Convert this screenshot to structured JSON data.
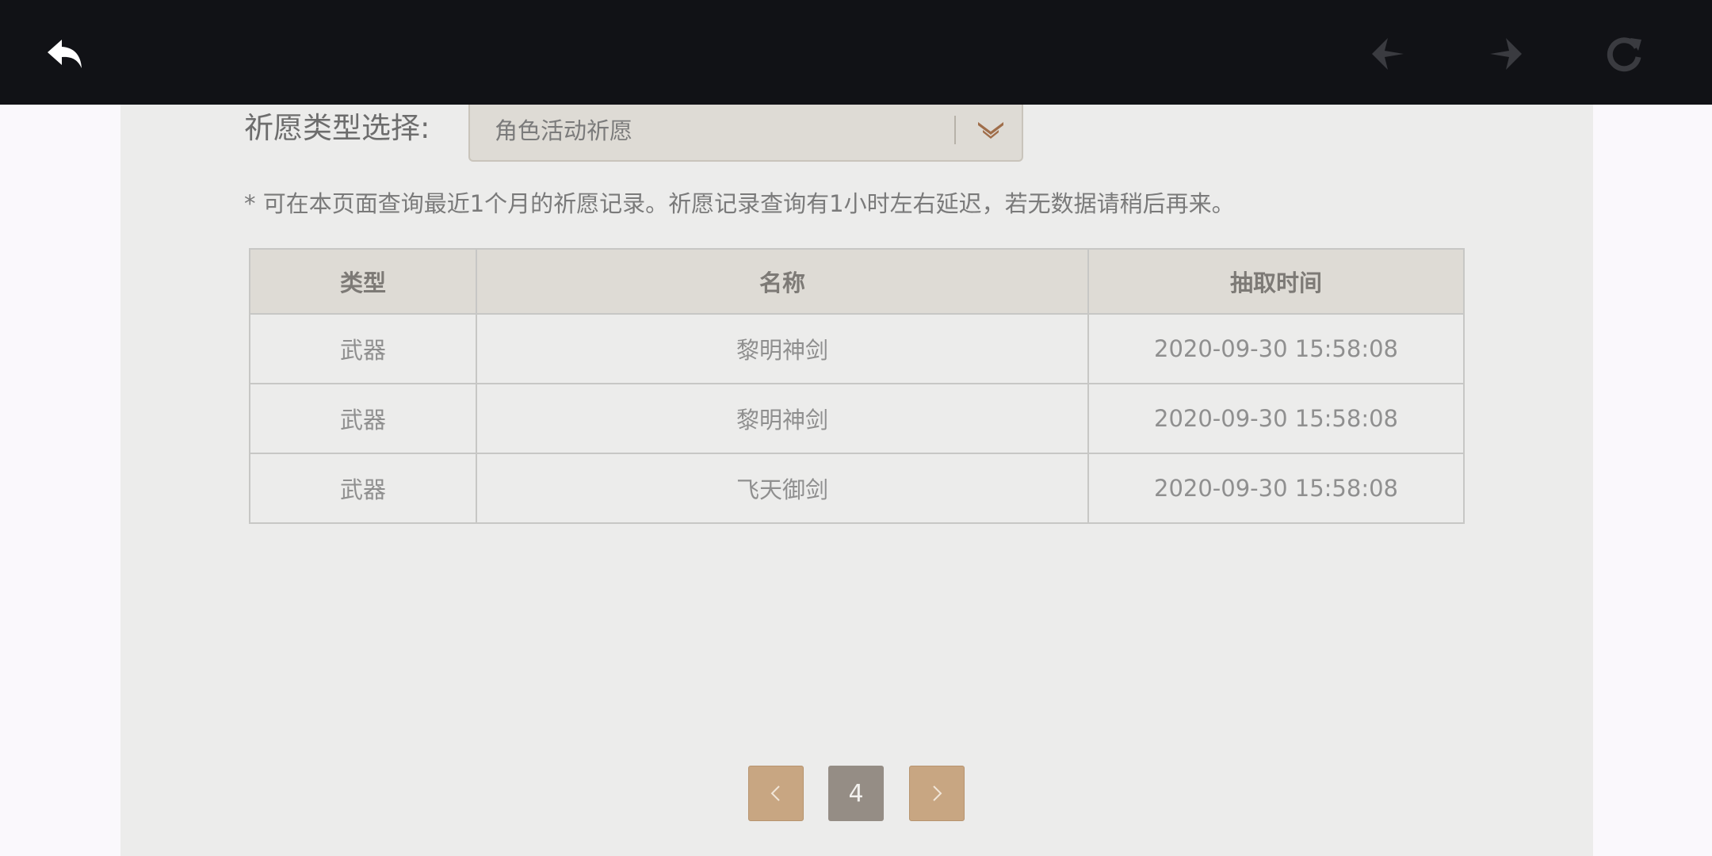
{
  "topbar": {
    "back_icon": "back-arrow-icon",
    "prev_icon": "navigate-back-icon",
    "next_icon": "navigate-forward-icon",
    "refresh_icon": "refresh-icon"
  },
  "filter": {
    "label": "祈愿类型选择:",
    "selected": "角色活动祈愿"
  },
  "notice": "* 可在本页面查询最近1个月的祈愿记录。祈愿记录查询有1小时左右延迟，若无数据请稍后再来。",
  "table": {
    "headers": [
      "类型",
      "名称",
      "抽取时间"
    ],
    "rows": [
      [
        "武器",
        "黎明神剑",
        "2020-09-30 15:58:08"
      ],
      [
        "武器",
        "黎明神剑",
        "2020-09-30 15:58:08"
      ],
      [
        "武器",
        "飞天御剑",
        "2020-09-30 15:58:08"
      ]
    ]
  },
  "pagination": {
    "current_page": "4"
  },
  "colors": {
    "topbar": "#111216",
    "accent": "#c8a682",
    "active_page": "#958d85"
  }
}
